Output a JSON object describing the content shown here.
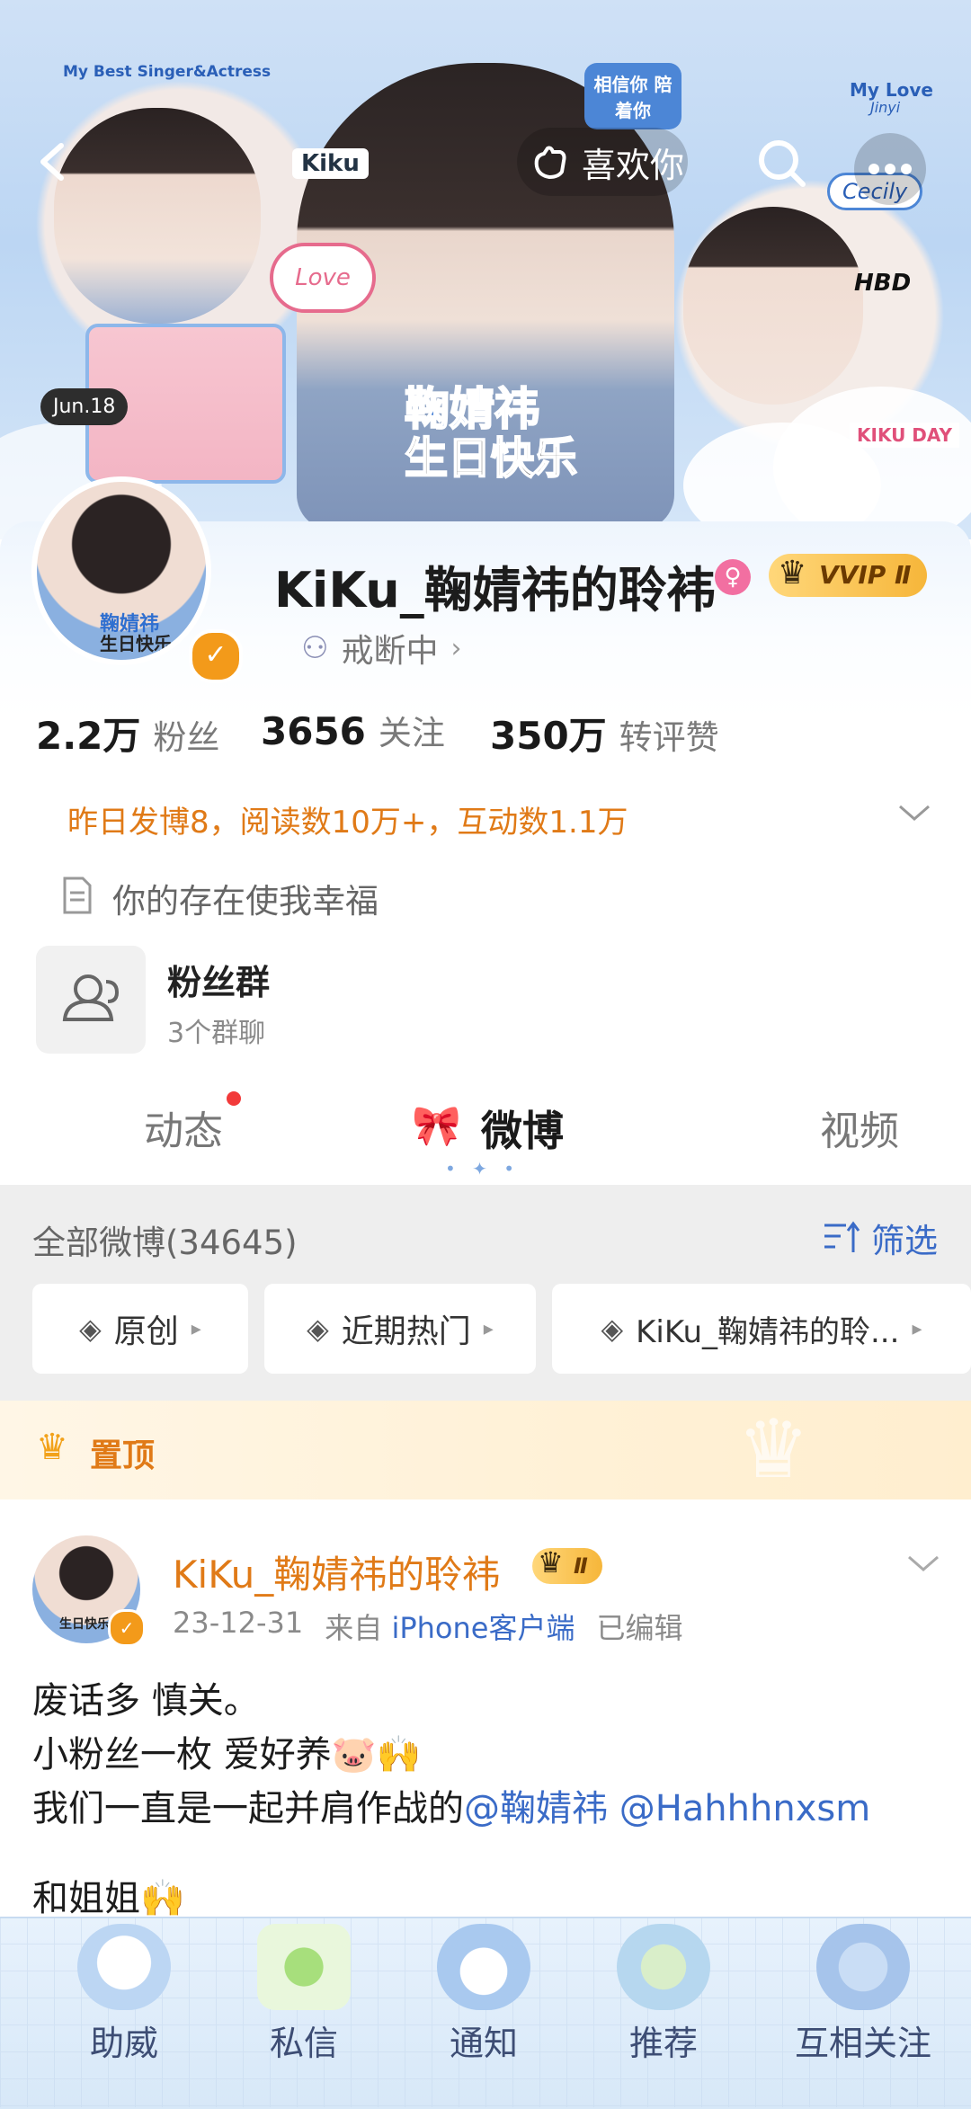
{
  "header": {
    "like_label": "喜欢你",
    "icons": [
      "back-arrow-icon",
      "hand-heart-icon",
      "search-icon",
      "more-dots-icon"
    ]
  },
  "banner_text": {
    "top_left": "My Best Singer&Actress",
    "name_tag": "Kiku",
    "bubble": "相信你 陪着你",
    "top_right": "My Love",
    "top_right_sub": "Jinyi",
    "love": "Love",
    "date": "Jun.18",
    "center_line1": "鞠婧祎",
    "center_line2": "生日快乐",
    "cecily": "Cecily",
    "hbd": "HBD",
    "kiku_day": "KIKU DAY"
  },
  "profile": {
    "avatar_line1": "鞠婧祎",
    "avatar_line2": "生日快乐",
    "username": "KiKu_鞠婧祎的聆袆",
    "vip": "VVIP Ⅱ",
    "status": "戒断中",
    "stats": [
      {
        "value": "2.2万",
        "label": "粉丝"
      },
      {
        "value": "3656",
        "label": "关注"
      },
      {
        "value": "350万",
        "label": "转评赞"
      }
    ],
    "activity": "昨日发博8，阅读数10万+，互动数1.1万",
    "bio": "你的存在使我幸福",
    "fan_group_title": "粉丝群",
    "fan_group_sub": "3个群聊"
  },
  "tabs": [
    "动态",
    "微博",
    "视频"
  ],
  "filter": {
    "all_label": "全部微博(34645)",
    "filter_label": "筛选",
    "chips": [
      "原创",
      "近期热门",
      "KiKu_鞠婧祎的聆..."
    ]
  },
  "pinned_label": "置顶",
  "post": {
    "avatar_text": "生日快乐",
    "author": "KiKu_鞠婧祎的聆袆",
    "level": "Ⅱ",
    "date": "23-12-31",
    "source_prefix": "来自",
    "source": "iPhone客户端",
    "edited": "已编辑",
    "line1": "废话多 慎关。",
    "line2": "小粉丝一枚 爱好养🐷🙌",
    "line3_prefix": "我们一直是一起并肩作战的",
    "mention1": "@鞠婧祎",
    "mention2": "@Hahhhnxsm",
    "line4": "和姐姐🙌"
  },
  "tabbar": [
    {
      "label": "助威",
      "icon": "cloud-face-icon"
    },
    {
      "label": "私信",
      "icon": "apple-icon"
    },
    {
      "label": "通知",
      "icon": "cake-icon"
    },
    {
      "label": "推荐",
      "icon": "bubbles-icon"
    },
    {
      "label": "互相关注",
      "icon": "star-icon"
    }
  ],
  "colors": {
    "accent_orange": "#e07a17",
    "link_blue": "#3a6bc7",
    "vip_gold": "#f3b32a",
    "notify_red": "#f23a3a"
  }
}
